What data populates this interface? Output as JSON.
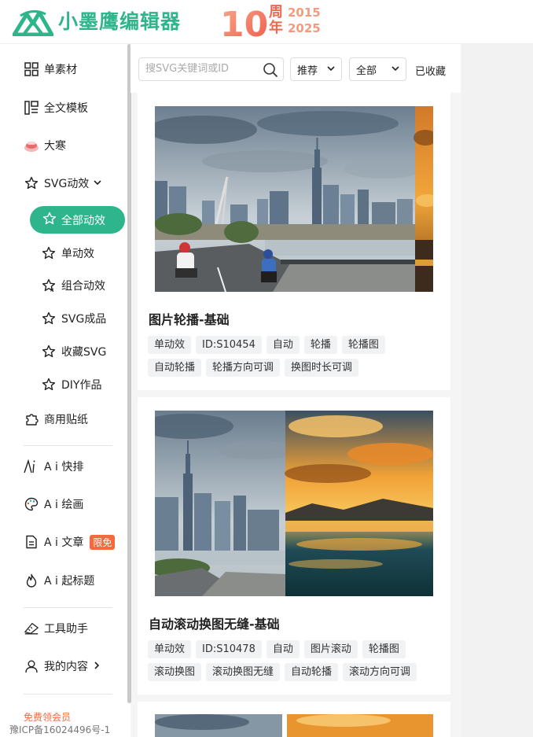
{
  "header": {
    "brand": "小墨鹰编辑器",
    "anniversary_number": "10",
    "anniversary_char1": "周",
    "anniversary_char2": "年",
    "year_start": "2015",
    "year_end": "2025"
  },
  "sidebar": {
    "items": [
      {
        "label": "单素材",
        "icon": "grid-icon"
      },
      {
        "label": "全文模板",
        "icon": "template-icon"
      },
      {
        "label": "大寒",
        "icon": "festival-icon"
      },
      {
        "label": "SVG动效",
        "icon": "star-icon"
      }
    ],
    "sub_items": [
      {
        "label": "全部动效",
        "active": true
      },
      {
        "label": "单动效"
      },
      {
        "label": "组合动效"
      },
      {
        "label": "SVG成品"
      },
      {
        "label": "收藏SVG"
      },
      {
        "label": "DIY作品"
      }
    ],
    "sticker": "商用贴纸",
    "ai_items": [
      {
        "label": "A i 快排"
      },
      {
        "label": "A i 绘画"
      },
      {
        "label": "A i 文章",
        "badge": "限免"
      },
      {
        "label": "A i 起标题"
      }
    ],
    "tools": "工具助手",
    "my_content": "我的内容",
    "vip_hint": "免费领会员",
    "icp": "豫ICP备16024496号-1"
  },
  "toolbar": {
    "search_placeholder": "搜SVG关键词或ID",
    "sort_value": "推荐",
    "filter_value": "全部",
    "favorited": "已收藏"
  },
  "cards": [
    {
      "title": "图片轮播-基础",
      "tags": [
        "单动效",
        "ID:S10454",
        "自动",
        "轮播",
        "轮播图",
        "自动轮播",
        "轮播方向可调",
        "换图时长可调"
      ]
    },
    {
      "title": "自动滚动换图无缝-基础",
      "tags": [
        "单动效",
        "ID:S10478",
        "自动",
        "图片滚动",
        "轮播图",
        "滚动换图",
        "滚动换图无缝",
        "自动轮播",
        "滚动方向可调"
      ]
    }
  ],
  "colors": {
    "brand_green": "#2fb58c",
    "accent_orange": "#f26a3d"
  }
}
